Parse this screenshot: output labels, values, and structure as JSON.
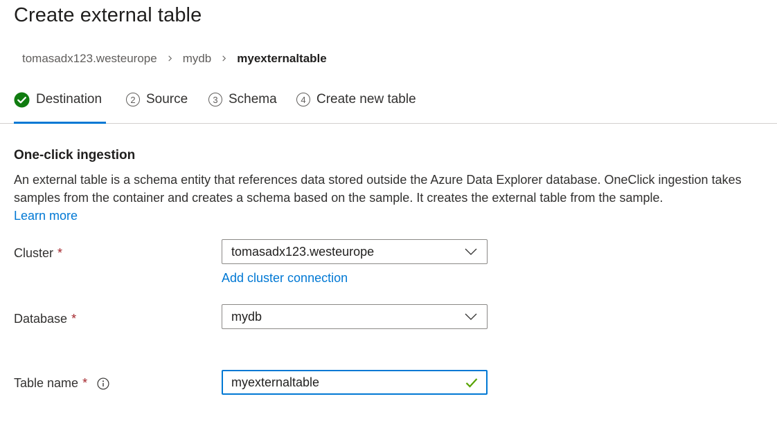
{
  "page": {
    "title": "Create external table"
  },
  "breadcrumb": {
    "items": [
      "tomasadx123.westeurope",
      "mydb",
      "myexternaltable"
    ]
  },
  "tabs": [
    {
      "num": "",
      "label": "Destination",
      "state": "complete"
    },
    {
      "num": "2",
      "label": "Source",
      "state": "pending"
    },
    {
      "num": "3",
      "label": "Schema",
      "state": "pending"
    },
    {
      "num": "4",
      "label": "Create new table",
      "state": "pending"
    }
  ],
  "intro": {
    "heading": "One-click ingestion",
    "description": "An external table is a schema entity that references data stored outside the Azure Data Explorer database. OneClick ingestion takes samples from the container and creates a schema based on the sample. It creates the external table from the sample.",
    "learn_more": "Learn more"
  },
  "form": {
    "cluster": {
      "label": "Cluster",
      "required": "*",
      "value": "tomasadx123.westeurope",
      "add_link": "Add cluster connection"
    },
    "database": {
      "label": "Database",
      "required": "*",
      "value": "mydb"
    },
    "table_name": {
      "label": "Table name",
      "required": "*",
      "value": "myexternaltable"
    }
  },
  "colors": {
    "accent": "#0078d4",
    "success": "#107c10",
    "required": "#a4262c"
  }
}
